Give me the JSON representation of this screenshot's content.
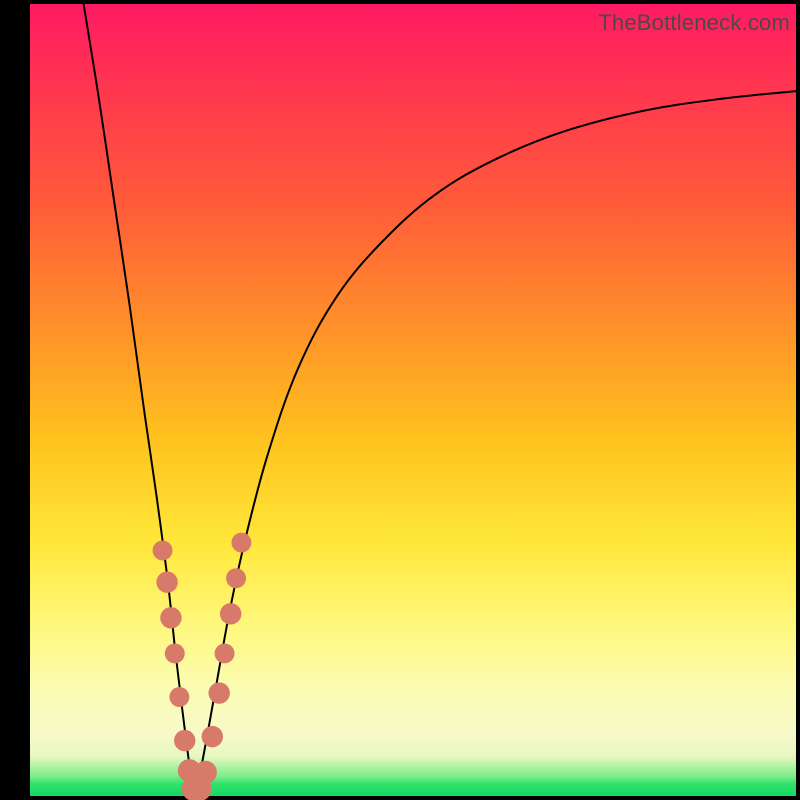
{
  "watermark": "TheBottleneck.com",
  "colors": {
    "frame": "#000000",
    "curve": "#000000",
    "marker": "#d77a6a",
    "gradient_stops": [
      "#ff1a63",
      "#ff2f53",
      "#ff5a3a",
      "#ff8e2a",
      "#ffc21e",
      "#ffe73a",
      "#fff77a",
      "#fbfcb0",
      "#f7fac9",
      "#e7f7c0",
      "#7ded8a",
      "#2fe26a",
      "#15d862"
    ]
  },
  "chart_data": {
    "type": "line",
    "title": "",
    "xlabel": "",
    "ylabel": "",
    "xlim": [
      0,
      100
    ],
    "ylim": [
      0,
      100
    ],
    "note": "Axes are unlabeled in the source image; x and y below are percentages of the plot area (x from left, y from bottom). The curve forms a sharp V near x≈21 with minimum ≈0, rising steeply on both sides. Markers cluster along both branches near the trough.",
    "series": [
      {
        "name": "curve",
        "x": [
          7.0,
          9.0,
          11.0,
          13.0,
          15.0,
          16.5,
          18.0,
          19.0,
          20.0,
          20.8,
          21.4,
          22.2,
          23.2,
          24.5,
          26.0,
          28.0,
          31.0,
          35.0,
          40.0,
          46.0,
          53.0,
          61.0,
          70.0,
          80.0,
          90.0,
          100.0
        ],
        "y": [
          100.0,
          88.0,
          75.0,
          62.0,
          48.0,
          38.0,
          27.0,
          18.0,
          10.0,
          4.0,
          0.5,
          3.0,
          8.0,
          15.0,
          23.0,
          32.0,
          43.0,
          54.0,
          63.0,
          70.0,
          76.0,
          80.5,
          84.0,
          86.5,
          88.0,
          89.0
        ]
      }
    ],
    "markers": {
      "name": "highlight-dots",
      "points": [
        {
          "x": 17.3,
          "y": 31.0,
          "r": 1.3
        },
        {
          "x": 17.9,
          "y": 27.0,
          "r": 1.4
        },
        {
          "x": 18.4,
          "y": 22.5,
          "r": 1.4
        },
        {
          "x": 18.9,
          "y": 18.0,
          "r": 1.3
        },
        {
          "x": 19.5,
          "y": 12.5,
          "r": 1.3
        },
        {
          "x": 20.2,
          "y": 7.0,
          "r": 1.4
        },
        {
          "x": 20.8,
          "y": 3.2,
          "r": 1.5
        },
        {
          "x": 21.4,
          "y": 0.9,
          "r": 1.6
        },
        {
          "x": 22.1,
          "y": 0.9,
          "r": 1.6
        },
        {
          "x": 22.9,
          "y": 3.0,
          "r": 1.5
        },
        {
          "x": 23.8,
          "y": 7.5,
          "r": 1.4
        },
        {
          "x": 24.7,
          "y": 13.0,
          "r": 1.4
        },
        {
          "x": 25.4,
          "y": 18.0,
          "r": 1.3
        },
        {
          "x": 26.2,
          "y": 23.0,
          "r": 1.4
        },
        {
          "x": 26.9,
          "y": 27.5,
          "r": 1.3
        },
        {
          "x": 27.6,
          "y": 32.0,
          "r": 1.3
        }
      ]
    }
  }
}
